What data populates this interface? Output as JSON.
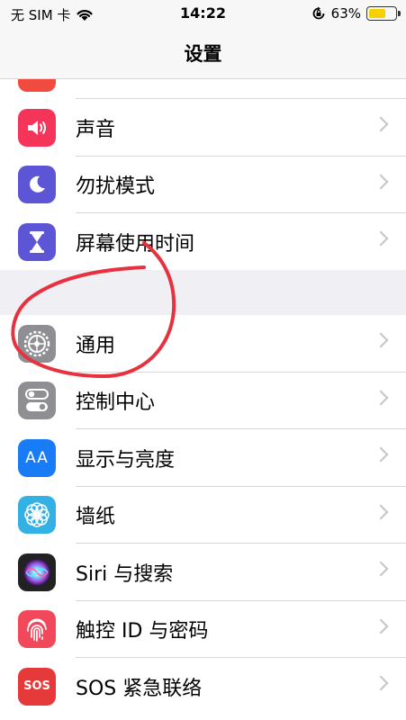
{
  "status_bar": {
    "carrier": "无 SIM 卡",
    "time": "14:22",
    "battery_percent": "63%",
    "battery_level": 0.63
  },
  "nav": {
    "title": "设置"
  },
  "group1": [
    {
      "label": "声音",
      "icon": "speaker-icon",
      "color": "#f5345a"
    },
    {
      "label": "勿扰模式",
      "icon": "moon-icon",
      "color": "#5c55d6"
    },
    {
      "label": "屏幕使用时间",
      "icon": "hourglass-icon",
      "color": "#5c55d6"
    }
  ],
  "group2": [
    {
      "label": "通用",
      "icon": "gear-icon",
      "color": "#8e8e93"
    },
    {
      "label": "控制中心",
      "icon": "toggles-icon",
      "color": "#8e8e93"
    },
    {
      "label": "显示与亮度",
      "icon": "text-size-icon",
      "color": "#1a7cf5",
      "icon_text": "AA"
    },
    {
      "label": "墙纸",
      "icon": "flower-icon",
      "color": "#33b1e4"
    },
    {
      "label": "Siri 与搜索",
      "icon": "siri-icon",
      "color": "#222222"
    },
    {
      "label": "触控 ID 与密码",
      "icon": "fingerprint-icon",
      "color": "#f1485b"
    },
    {
      "label": "SOS 紧急联络",
      "icon": "sos-icon",
      "color": "#e6393a",
      "icon_text": "SOS"
    }
  ],
  "colors": {
    "annotation": "#e8313f",
    "chevron": "#c4c4c9"
  }
}
